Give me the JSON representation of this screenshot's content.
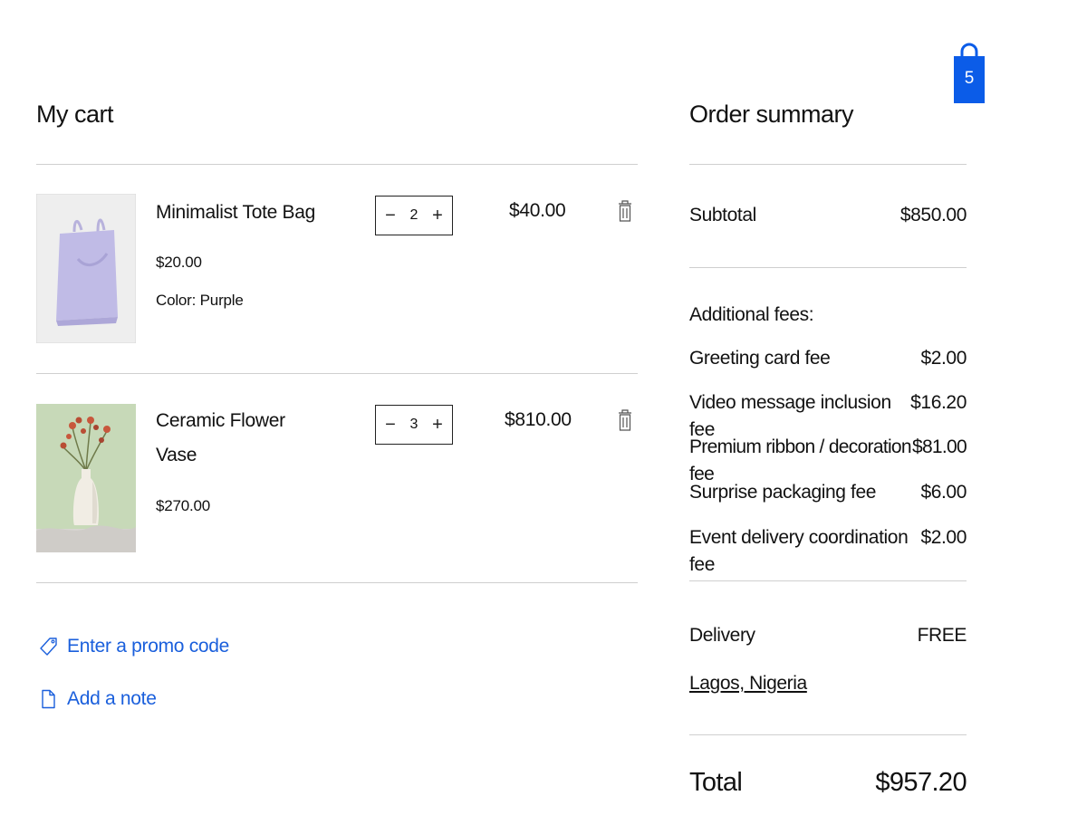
{
  "header": {
    "cart_count": "5"
  },
  "cart": {
    "title": "My cart",
    "items": [
      {
        "name": "Minimalist Tote Bag",
        "unit_price": "$20.00",
        "variant": "Color: Purple",
        "quantity": "2",
        "line_total": "$40.00"
      },
      {
        "name": "Ceramic Flower Vase",
        "unit_price": "$270.00",
        "variant": "",
        "quantity": "3",
        "line_total": "$810.00"
      }
    ],
    "promo_label": "Enter a promo code",
    "note_label": "Add a note"
  },
  "summary": {
    "title": "Order summary",
    "subtotal_label": "Subtotal",
    "subtotal_value": "$850.00",
    "fees_title": "Additional fees:",
    "fees": [
      {
        "label": "Greeting card fee",
        "value": "$2.00"
      },
      {
        "label": "Video message inclusion fee",
        "value": "$16.20"
      },
      {
        "label": "Premium ribbon / decoration fee",
        "value": "$81.00"
      },
      {
        "label": "Surprise packaging fee",
        "value": "$6.00"
      },
      {
        "label": "Event delivery coordination fee",
        "value": "$2.00"
      }
    ],
    "delivery_label": "Delivery",
    "delivery_value": "FREE",
    "location": "Lagos, Nigeria",
    "total_label": "Total",
    "total_value": "$957.20"
  },
  "colors": {
    "accent": "#0b5ce8",
    "link": "#1a5fdc",
    "divider": "#cfcfcf"
  }
}
